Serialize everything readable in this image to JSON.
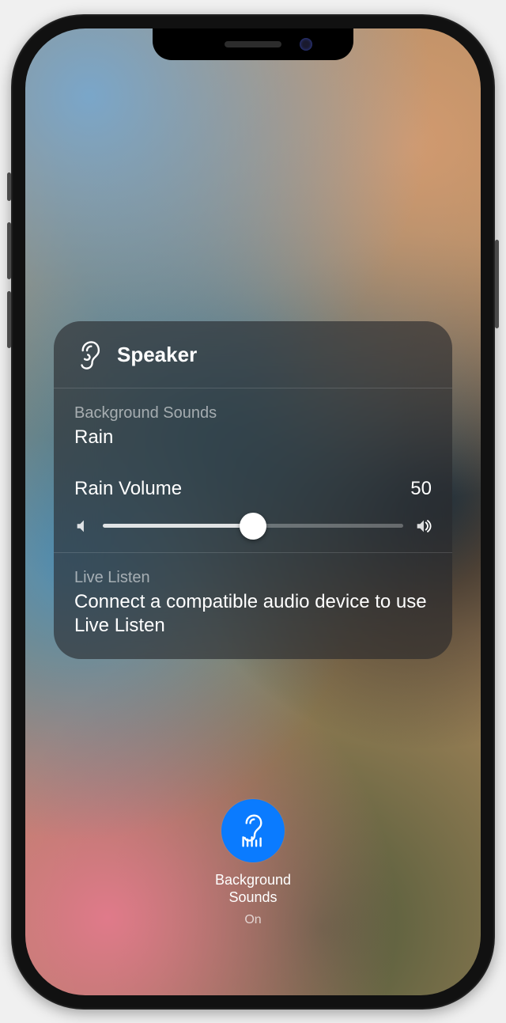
{
  "panel": {
    "title": "Speaker",
    "background_sounds": {
      "caption": "Background Sounds",
      "value": "Rain"
    },
    "volume": {
      "label": "Rain Volume",
      "value": "50",
      "percent": 50
    },
    "live_listen": {
      "caption": "Live Listen",
      "message": "Connect a compatible audio device to use Live Listen"
    }
  },
  "toggle": {
    "label": "Background\nSounds",
    "state": "On",
    "accent": "#0a7bff"
  }
}
